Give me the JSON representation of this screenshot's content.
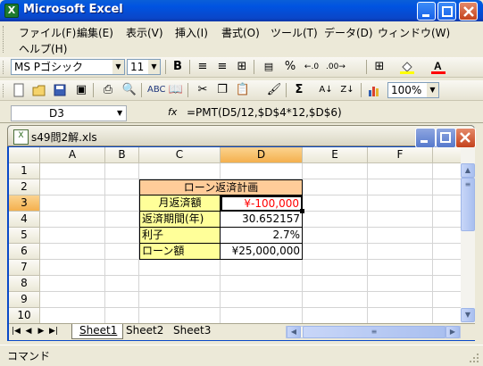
{
  "app": {
    "title": "Microsoft Excel"
  },
  "menu": {
    "items": [
      "ファイル(F)",
      "編集(E)",
      "表示(V)",
      "挿入(I)",
      "書式(O)",
      "ツール(T)",
      "データ(D)",
      "ウィンドウ(W)"
    ],
    "help": "ヘルプ(H)"
  },
  "format_toolbar": {
    "font": "MS Pゴシック",
    "size": "11",
    "bold": "B",
    "percent": "%"
  },
  "standard_toolbar": {
    "zoom": "100%"
  },
  "formula_bar": {
    "cell_ref": "D3",
    "fx": "fx",
    "formula": "=PMT(D5/12,$D$4*12,$D$6)"
  },
  "workbook": {
    "title": "s49問2解.xls"
  },
  "sheet": {
    "columns": [
      "A",
      "B",
      "C",
      "D",
      "E",
      "F"
    ],
    "rows": [
      "1",
      "2",
      "3",
      "4",
      "5",
      "6",
      "7",
      "8",
      "9",
      "10"
    ],
    "table_title": "ローン返済計画",
    "labels": [
      "月返済額",
      "返済期間(年)",
      "利子",
      "ローン額"
    ],
    "values": [
      "¥-100,000",
      "30.652157",
      "2.7%",
      "¥25,000,000"
    ]
  },
  "tabs": [
    "Sheet1",
    "Sheet2",
    "Sheet3"
  ],
  "status": {
    "mode": "コマンド"
  },
  "colors": {
    "label_fill": "#FFFF99",
    "title_fill": "#FFCC99",
    "negative": "#FF0000",
    "selected_header": "#F6C072"
  }
}
